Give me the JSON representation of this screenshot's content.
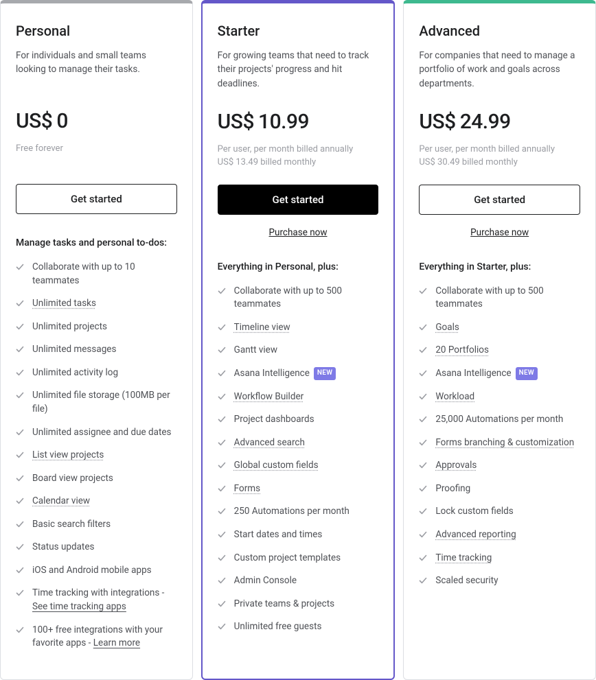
{
  "badges": {
    "new": "NEW"
  },
  "plans": [
    {
      "id": "personal",
      "name": "Personal",
      "accent": "accent-gray",
      "description": "For individuals and small teams looking to manage their tasks.",
      "currency": "US$",
      "price": "0",
      "sub_line1": "Free forever",
      "sub_line2": "",
      "cta_label": "Get started",
      "cta_style": "outline",
      "purchase_label": "",
      "features_title": "Manage tasks and personal to-dos:",
      "features": [
        {
          "segments": [
            {
              "t": "Collaborate with up to 10 teammates"
            }
          ]
        },
        {
          "segments": [
            {
              "t": "Unlimited tasks",
              "u": "dotted"
            }
          ]
        },
        {
          "segments": [
            {
              "t": "Unlimited projects"
            }
          ]
        },
        {
          "segments": [
            {
              "t": "Unlimited messages"
            }
          ]
        },
        {
          "segments": [
            {
              "t": "Unlimited activity log"
            }
          ]
        },
        {
          "segments": [
            {
              "t": "Unlimited file storage (100MB per file)"
            }
          ]
        },
        {
          "segments": [
            {
              "t": "Unlimited assignee and due dates"
            }
          ]
        },
        {
          "segments": [
            {
              "t": "List view projects",
              "u": "dotted"
            }
          ]
        },
        {
          "segments": [
            {
              "t": "Board view projects"
            }
          ]
        },
        {
          "segments": [
            {
              "t": "Calendar view",
              "u": "dotted"
            }
          ]
        },
        {
          "segments": [
            {
              "t": "Basic search filters"
            }
          ]
        },
        {
          "segments": [
            {
              "t": "Status updates"
            }
          ]
        },
        {
          "segments": [
            {
              "t": "iOS and Android mobile apps"
            }
          ]
        },
        {
          "segments": [
            {
              "t": "Time tracking with integrations - "
            },
            {
              "t": "See time tracking apps",
              "u": "solid"
            }
          ]
        },
        {
          "segments": [
            {
              "t": "100+ free integrations with your favorite apps - "
            },
            {
              "t": "Learn more",
              "u": "solid"
            }
          ]
        }
      ]
    },
    {
      "id": "starter",
      "name": "Starter",
      "accent": "accent-purple",
      "description": "For growing teams that need to track their projects' progress and hit deadlines.",
      "currency": "US$",
      "price": "10.99",
      "sub_line1": "Per user, per month billed annually",
      "sub_line2": "US$ 13.49 billed monthly",
      "cta_label": "Get started",
      "cta_style": "primary",
      "purchase_label": "Purchase now",
      "features_title": "Everything in Personal, plus:",
      "features": [
        {
          "segments": [
            {
              "t": "Collaborate with up to 500 teammates"
            }
          ]
        },
        {
          "segments": [
            {
              "t": "Timeline view",
              "u": "dotted"
            }
          ]
        },
        {
          "segments": [
            {
              "t": "Gantt view"
            }
          ]
        },
        {
          "segments": [
            {
              "t": "Asana Intelligence"
            }
          ],
          "badge": "new"
        },
        {
          "segments": [
            {
              "t": "Workflow Builder",
              "u": "dotted"
            }
          ]
        },
        {
          "segments": [
            {
              "t": "Project dashboards"
            }
          ]
        },
        {
          "segments": [
            {
              "t": "Advanced search",
              "u": "dotted"
            }
          ]
        },
        {
          "segments": [
            {
              "t": "Global custom fields",
              "u": "dotted"
            }
          ]
        },
        {
          "segments": [
            {
              "t": "Forms",
              "u": "dotted"
            }
          ]
        },
        {
          "segments": [
            {
              "t": "250 Automations per month"
            }
          ]
        },
        {
          "segments": [
            {
              "t": "Start dates and times"
            }
          ]
        },
        {
          "segments": [
            {
              "t": "Custom project templates"
            }
          ]
        },
        {
          "segments": [
            {
              "t": "Admin Console"
            }
          ]
        },
        {
          "segments": [
            {
              "t": "Private teams & projects"
            }
          ]
        },
        {
          "segments": [
            {
              "t": "Unlimited free guests"
            }
          ]
        }
      ]
    },
    {
      "id": "advanced",
      "name": "Advanced",
      "accent": "accent-green",
      "description": "For companies that need to manage a portfolio of work and goals across departments.",
      "currency": "US$",
      "price": "24.99",
      "sub_line1": "Per user, per month billed annually",
      "sub_line2": "US$ 30.49 billed monthly",
      "cta_label": "Get started",
      "cta_style": "outline",
      "purchase_label": "Purchase now",
      "features_title": "Everything in Starter, plus:",
      "features": [
        {
          "segments": [
            {
              "t": "Collaborate with up to 500 teammates"
            }
          ]
        },
        {
          "segments": [
            {
              "t": "Goals",
              "u": "dotted"
            }
          ]
        },
        {
          "segments": [
            {
              "t": "20 Portfolios",
              "u": "dotted"
            }
          ]
        },
        {
          "segments": [
            {
              "t": "Asana Intelligence"
            }
          ],
          "badge": "new"
        },
        {
          "segments": [
            {
              "t": "Workload",
              "u": "dotted"
            }
          ]
        },
        {
          "segments": [
            {
              "t": "25,000 Automations per month"
            }
          ]
        },
        {
          "segments": [
            {
              "t": "Forms branching & customization",
              "u": "dotted"
            }
          ]
        },
        {
          "segments": [
            {
              "t": "Approvals",
              "u": "dotted"
            }
          ]
        },
        {
          "segments": [
            {
              "t": "Proofing"
            }
          ]
        },
        {
          "segments": [
            {
              "t": "Lock custom fields"
            }
          ]
        },
        {
          "segments": [
            {
              "t": "Advanced reporting",
              "u": "dotted"
            }
          ]
        },
        {
          "segments": [
            {
              "t": "Time tracking",
              "u": "dotted"
            }
          ]
        },
        {
          "segments": [
            {
              "t": "Scaled security"
            }
          ]
        }
      ]
    }
  ]
}
